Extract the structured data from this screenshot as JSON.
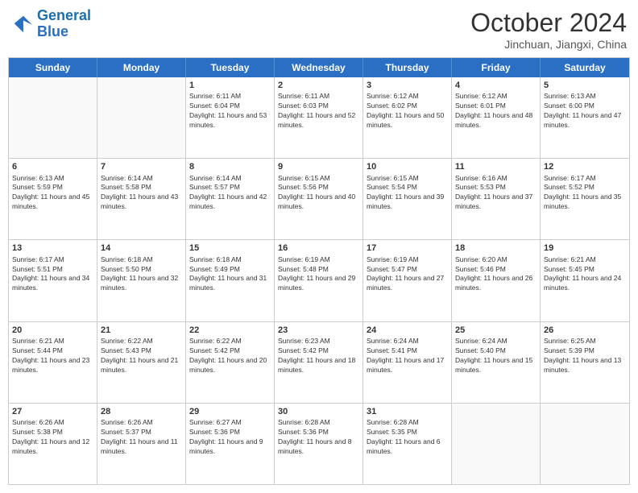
{
  "header": {
    "logo_line1": "General",
    "logo_line2": "Blue",
    "title": "October 2024",
    "subtitle": "Jinchuan, Jiangxi, China"
  },
  "weekdays": [
    "Sunday",
    "Monday",
    "Tuesday",
    "Wednesday",
    "Thursday",
    "Friday",
    "Saturday"
  ],
  "weeks": [
    [
      {
        "day": "",
        "empty": true
      },
      {
        "day": "",
        "empty": true
      },
      {
        "day": "1",
        "sunrise": "6:11 AM",
        "sunset": "6:04 PM",
        "daylight": "11 hours and 53 minutes."
      },
      {
        "day": "2",
        "sunrise": "6:11 AM",
        "sunset": "6:03 PM",
        "daylight": "11 hours and 52 minutes."
      },
      {
        "day": "3",
        "sunrise": "6:12 AM",
        "sunset": "6:02 PM",
        "daylight": "11 hours and 50 minutes."
      },
      {
        "day": "4",
        "sunrise": "6:12 AM",
        "sunset": "6:01 PM",
        "daylight": "11 hours and 48 minutes."
      },
      {
        "day": "5",
        "sunrise": "6:13 AM",
        "sunset": "6:00 PM",
        "daylight": "11 hours and 47 minutes."
      }
    ],
    [
      {
        "day": "6",
        "sunrise": "6:13 AM",
        "sunset": "5:59 PM",
        "daylight": "11 hours and 45 minutes."
      },
      {
        "day": "7",
        "sunrise": "6:14 AM",
        "sunset": "5:58 PM",
        "daylight": "11 hours and 43 minutes."
      },
      {
        "day": "8",
        "sunrise": "6:14 AM",
        "sunset": "5:57 PM",
        "daylight": "11 hours and 42 minutes."
      },
      {
        "day": "9",
        "sunrise": "6:15 AM",
        "sunset": "5:56 PM",
        "daylight": "11 hours and 40 minutes."
      },
      {
        "day": "10",
        "sunrise": "6:15 AM",
        "sunset": "5:54 PM",
        "daylight": "11 hours and 39 minutes."
      },
      {
        "day": "11",
        "sunrise": "6:16 AM",
        "sunset": "5:53 PM",
        "daylight": "11 hours and 37 minutes."
      },
      {
        "day": "12",
        "sunrise": "6:17 AM",
        "sunset": "5:52 PM",
        "daylight": "11 hours and 35 minutes."
      }
    ],
    [
      {
        "day": "13",
        "sunrise": "6:17 AM",
        "sunset": "5:51 PM",
        "daylight": "11 hours and 34 minutes."
      },
      {
        "day": "14",
        "sunrise": "6:18 AM",
        "sunset": "5:50 PM",
        "daylight": "11 hours and 32 minutes."
      },
      {
        "day": "15",
        "sunrise": "6:18 AM",
        "sunset": "5:49 PM",
        "daylight": "11 hours and 31 minutes."
      },
      {
        "day": "16",
        "sunrise": "6:19 AM",
        "sunset": "5:48 PM",
        "daylight": "11 hours and 29 minutes."
      },
      {
        "day": "17",
        "sunrise": "6:19 AM",
        "sunset": "5:47 PM",
        "daylight": "11 hours and 27 minutes."
      },
      {
        "day": "18",
        "sunrise": "6:20 AM",
        "sunset": "5:46 PM",
        "daylight": "11 hours and 26 minutes."
      },
      {
        "day": "19",
        "sunrise": "6:21 AM",
        "sunset": "5:45 PM",
        "daylight": "11 hours and 24 minutes."
      }
    ],
    [
      {
        "day": "20",
        "sunrise": "6:21 AM",
        "sunset": "5:44 PM",
        "daylight": "11 hours and 23 minutes."
      },
      {
        "day": "21",
        "sunrise": "6:22 AM",
        "sunset": "5:43 PM",
        "daylight": "11 hours and 21 minutes."
      },
      {
        "day": "22",
        "sunrise": "6:22 AM",
        "sunset": "5:42 PM",
        "daylight": "11 hours and 20 minutes."
      },
      {
        "day": "23",
        "sunrise": "6:23 AM",
        "sunset": "5:42 PM",
        "daylight": "11 hours and 18 minutes."
      },
      {
        "day": "24",
        "sunrise": "6:24 AM",
        "sunset": "5:41 PM",
        "daylight": "11 hours and 17 minutes."
      },
      {
        "day": "25",
        "sunrise": "6:24 AM",
        "sunset": "5:40 PM",
        "daylight": "11 hours and 15 minutes."
      },
      {
        "day": "26",
        "sunrise": "6:25 AM",
        "sunset": "5:39 PM",
        "daylight": "11 hours and 13 minutes."
      }
    ],
    [
      {
        "day": "27",
        "sunrise": "6:26 AM",
        "sunset": "5:38 PM",
        "daylight": "11 hours and 12 minutes."
      },
      {
        "day": "28",
        "sunrise": "6:26 AM",
        "sunset": "5:37 PM",
        "daylight": "11 hours and 11 minutes."
      },
      {
        "day": "29",
        "sunrise": "6:27 AM",
        "sunset": "5:36 PM",
        "daylight": "11 hours and 9 minutes."
      },
      {
        "day": "30",
        "sunrise": "6:28 AM",
        "sunset": "5:36 PM",
        "daylight": "11 hours and 8 minutes."
      },
      {
        "day": "31",
        "sunrise": "6:28 AM",
        "sunset": "5:35 PM",
        "daylight": "11 hours and 6 minutes."
      },
      {
        "day": "",
        "empty": true
      },
      {
        "day": "",
        "empty": true
      }
    ]
  ]
}
